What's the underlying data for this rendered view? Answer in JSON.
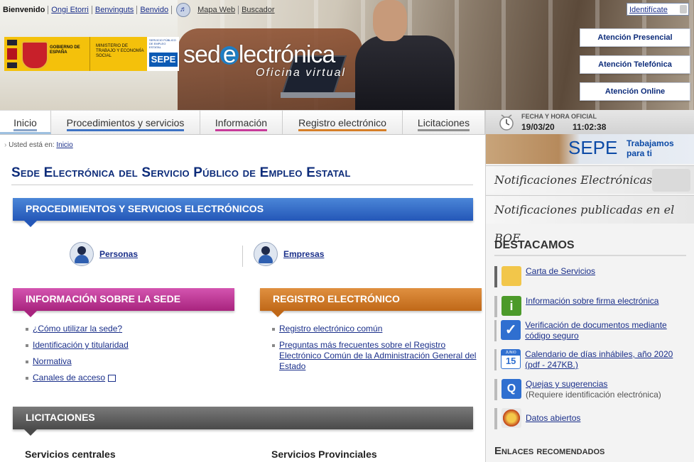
{
  "topbar": {
    "welcome": "Bienvenido",
    "languages": [
      "Ongi Etorri",
      "Benvinguts",
      "Benvido"
    ],
    "links": [
      "Mapa Web",
      "Buscador"
    ],
    "login": "Identifícate"
  },
  "header": {
    "logo_gobierno": "GOBIERNO DE ESPAÑA",
    "logo_ministerio": "MINISTERIO DE TRABAJO Y ECONOMÍA SOCIAL",
    "logo_sepe_small": "SERVICIO PÚBLICO DE EMPLEO ESTATAL",
    "logo_sepe": "SEPE",
    "site_title_pre": "sed",
    "site_title_e": "e",
    "site_title_post": "lectrónica",
    "site_subtitle": "Oficina virtual",
    "attention": [
      "Atención Presencial",
      "Atención Telefónica",
      "Atención Online"
    ]
  },
  "nav": {
    "tabs": [
      "Inicio",
      "Procedimientos y servicios",
      "Información",
      "Registro electrónico",
      "Licitaciones"
    ]
  },
  "breadcrumb": {
    "label": "Usted está en:",
    "current": "Inicio"
  },
  "main": {
    "title": "Sede Electrónica del Servicio Público de Empleo Estatal",
    "proc_section": "PROCEDIMIENTOS Y SERVICIOS ELECTRÓNICOS",
    "profiles": [
      "Personas",
      "Empresas"
    ],
    "info_section": "INFORMACIÓN SOBRE LA SEDE",
    "info_links": [
      "¿Cómo utilizar la sede?",
      "Identificación y titularidad",
      "Normativa",
      "Canales de acceso"
    ],
    "reg_section": "REGISTRO ELECTRÓNICO",
    "reg_links": [
      "Registro electrónico común",
      "Preguntas más frecuentes sobre el Registro Electrónico Común de la Administración General del Estado"
    ],
    "lic_section": "LICITACIONES",
    "lic_sub1": "Servicios centrales",
    "lic_sub2": "Servicios Provinciales"
  },
  "sidebar": {
    "clock_label": "FECHA Y HORA OFICIAL",
    "date": "19/03/20",
    "time": "11:02:38",
    "sepe_name": "SEPE",
    "sepe_slogan_1": "Trabajamos",
    "sepe_slogan_2": "para ti",
    "notif_1": "Notificaciones Electrónicas",
    "notif_2": "Notificaciones publicadas en el BOE",
    "dest_heading": "DESTACAMOS",
    "dest_items": [
      {
        "label": "Carta de Servicios",
        "note": ""
      },
      {
        "label": "Información sobre firma electrónica",
        "note": ""
      },
      {
        "label": "Verificación de documentos mediante código seguro",
        "note": ""
      },
      {
        "label": "Calendario de días inhábiles, año 2020 (pdf - 247KB.)",
        "note": ""
      },
      {
        "label": "Quejas y sugerencias",
        "note": "(Requiere identificación electrónica)"
      },
      {
        "label": "Datos abiertos",
        "note": ""
      }
    ],
    "cal_month": "JUNIO",
    "cal_day": "15",
    "enl_heading": "Enlaces recomendados"
  },
  "colors": {
    "blue_section": "#2457b8",
    "pink_section": "#a8247e",
    "orange_section": "#c06818",
    "gray_section": "#4a4a4a",
    "link": "#1a2f8a",
    "title": "#0d2c7a"
  },
  "icons": [
    "sound-icon",
    "lock-icon",
    "clock-icon",
    "person-icon",
    "company-icon",
    "external-link-icon",
    "charter-icon",
    "info-icon",
    "check-icon",
    "calendar-icon",
    "q-icon",
    "open-data-icon",
    "email-icon"
  ]
}
